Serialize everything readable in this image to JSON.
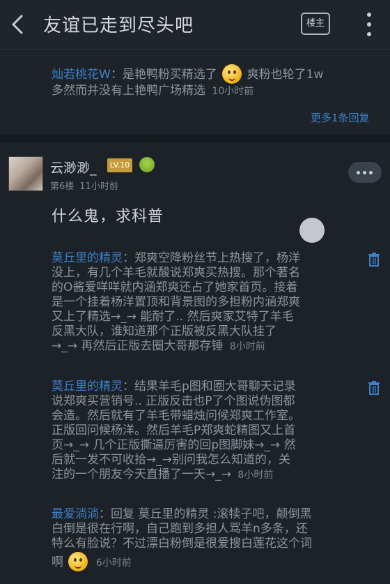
{
  "header": {
    "title": "友谊已走到尽头吧",
    "owner_label": "楼主"
  },
  "top_reply": {
    "author": "灿若桃花W",
    "text_before": "：是艳鸭粉买精选了",
    "text_after": "爽粉也轮了1w",
    "line2": "多然而并没有上艳鸭广场精选",
    "time": "10小时前",
    "more_label": "更多1条回复"
  },
  "post": {
    "username": "云渺渺_",
    "level": "LV.10",
    "floor": "第6楼",
    "time": "11小时前",
    "content": "什么鬼，求科普"
  },
  "replies": [
    {
      "author": "莫丘里的精灵",
      "lines": [
        "：郑爽空降粉丝节上热搜了，杨洋",
        "没上，有几个羊毛就酸说郑爽买热搜。那个著名",
        "的O酱爱咩咩就内涵郑爽还占了她家首页。接着",
        "是一个挂着杨洋置顶和背景图的多担粉内涵郑爽",
        "又上了精选→_→ 能耐了.. 然后爽家艾特了羊毛",
        "反黑大队，谁知道那个正版被反黑大队挂了",
        "→_→ 再然后正版去圈大哥那存锤"
      ],
      "time": "8小时前"
    },
    {
      "author": "莫丘里的精灵",
      "lines": [
        "：结果羊毛p图和圈大哥聊天记录",
        "说郑爽买营销号.. 正版反击也P了个图说伪图都",
        "会造。然后就有了羊毛带蜡烛问候郑爽工作室。",
        "正版回问候杨洋。然后羊毛P郑爽蛇精图又上首",
        "页→_→ 几个正版撕逼厉害的回p图脚妹→_→ 然",
        "后就一发不可收拾→_→别问我怎么知道的，关",
        "注的一个朋友今天直播了一天→_→"
      ],
      "time": "8小时前"
    },
    {
      "author": "最爱淌淌",
      "lines": [
        "：回复 莫丘里的精灵 :滚犊子吧，颠倒黑",
        "白倒是很在行啊，自己跑到多担人骂羊n多条，还",
        "特么有脸说？不过漂白粉倒是很爱搜白莲花这个词",
        "啊"
      ],
      "time": "6小时前"
    }
  ],
  "colors": {
    "background": "#1c2228",
    "link_blue": "#3d7fc8",
    "text": "#c9ced3",
    "delete_icon": "#3d7fc8"
  }
}
